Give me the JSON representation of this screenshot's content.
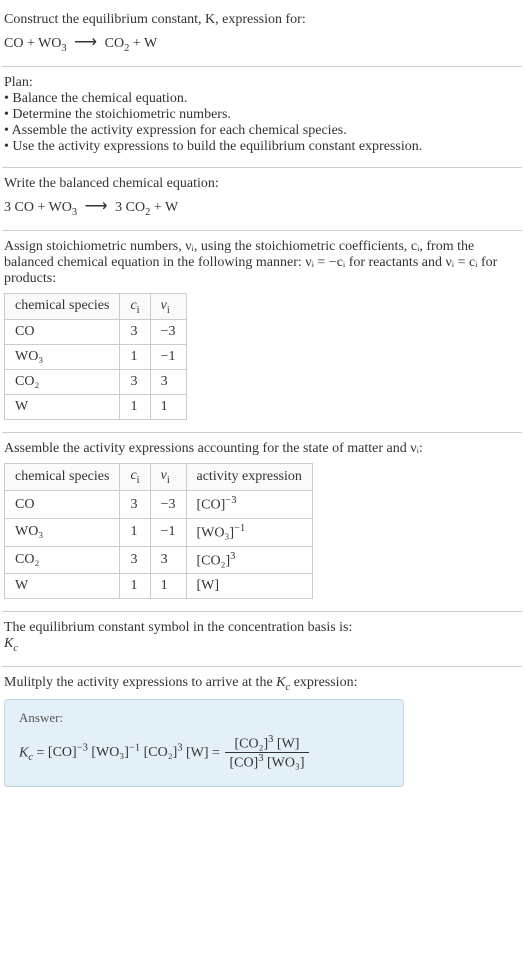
{
  "intro": {
    "line1": "Construct the equilibrium constant, K, expression for:",
    "equation_lhs": "CO + WO",
    "equation_lhs_sub": "3",
    "equation_rhs1": "CO",
    "equation_rhs1_sub": "2",
    "equation_rhs2": " + W"
  },
  "plan": {
    "title": "Plan:",
    "items": [
      "• Balance the chemical equation.",
      "• Determine the stoichiometric numbers.",
      "• Assemble the activity expression for each chemical species.",
      "• Use the activity expressions to build the equilibrium constant expression."
    ]
  },
  "balanced": {
    "text": "Write the balanced chemical equation:",
    "lhs": "3 CO + WO",
    "lhs_sub": "3",
    "rhs1": "3 CO",
    "rhs1_sub": "2",
    "rhs2": " + W"
  },
  "stoich_intro": "Assign stoichiometric numbers, νᵢ, using the stoichiometric coefficients, cᵢ, from the balanced chemical equation in the following manner: νᵢ = −cᵢ for reactants and νᵢ = cᵢ for products:",
  "table1": {
    "headers": [
      "chemical species",
      "cᵢ",
      "νᵢ"
    ],
    "rows": [
      [
        "CO",
        "3",
        "−3"
      ],
      [
        "WO₃",
        "1",
        "−1"
      ],
      [
        "CO₂",
        "3",
        "3"
      ],
      [
        "W",
        "1",
        "1"
      ]
    ]
  },
  "activity_intro": "Assemble the activity expressions accounting for the state of matter and νᵢ:",
  "table2": {
    "headers": [
      "chemical species",
      "cᵢ",
      "νᵢ",
      "activity expression"
    ],
    "rows": [
      {
        "sp": "CO",
        "c": "3",
        "v": "−3",
        "act_base": "[CO]",
        "act_exp": "−3"
      },
      {
        "sp": "WO₃",
        "c": "1",
        "v": "−1",
        "act_base": "[WO₃]",
        "act_exp": "−1"
      },
      {
        "sp": "CO₂",
        "c": "3",
        "v": "3",
        "act_base": "[CO₂]",
        "act_exp": "3"
      },
      {
        "sp": "W",
        "c": "1",
        "v": "1",
        "act_base": "[W]",
        "act_exp": ""
      }
    ]
  },
  "kc_symbol_line1": "The equilibrium constant symbol in the concentration basis is:",
  "kc_symbol_line2": "K",
  "kc_symbol_sub": "c",
  "multiply_line": "Mulitply the activity expressions to arrive at the K_c expression:",
  "answer": {
    "label": "Answer:",
    "kc": "K",
    "kc_sub": "c",
    "eq_sign": " = ",
    "t1_base": "[CO]",
    "t1_exp": "−3",
    "t2_base": "[WO₃]",
    "t2_exp": "−1",
    "t3_base": "[CO₂]",
    "t3_exp": "3",
    "t4_base": "[W]",
    "frac_num1_base": "[CO₂]",
    "frac_num1_exp": "3",
    "frac_num2_base": "[W]",
    "frac_den1_base": "[CO]",
    "frac_den1_exp": "3",
    "frac_den2_base": "[WO₃]"
  },
  "chart_data": {
    "type": "table",
    "tables": [
      {
        "title": "Stoichiometric numbers",
        "columns": [
          "chemical species",
          "c_i",
          "nu_i"
        ],
        "rows": [
          [
            "CO",
            3,
            -3
          ],
          [
            "WO3",
            1,
            -1
          ],
          [
            "CO2",
            3,
            3
          ],
          [
            "W",
            1,
            1
          ]
        ]
      },
      {
        "title": "Activity expressions",
        "columns": [
          "chemical species",
          "c_i",
          "nu_i",
          "activity expression"
        ],
        "rows": [
          [
            "CO",
            3,
            -3,
            "[CO]^-3"
          ],
          [
            "WO3",
            1,
            -1,
            "[WO3]^-1"
          ],
          [
            "CO2",
            3,
            3,
            "[CO2]^3"
          ],
          [
            "W",
            1,
            1,
            "[W]"
          ]
        ]
      }
    ]
  }
}
